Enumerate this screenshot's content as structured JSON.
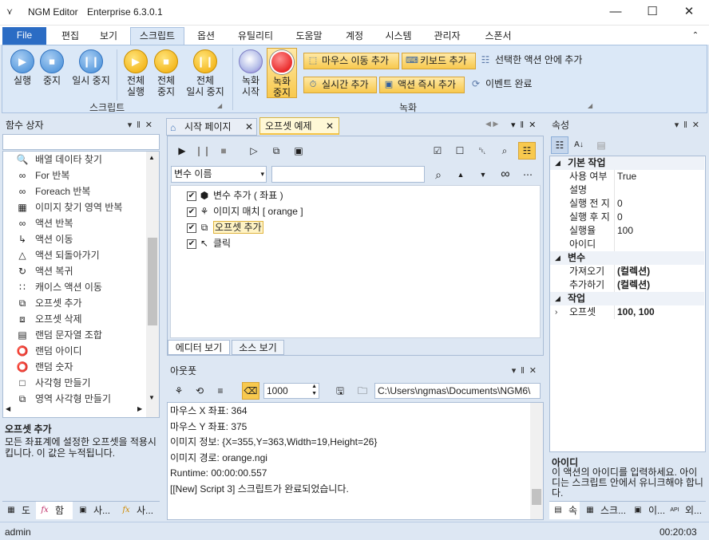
{
  "window": {
    "app_name": "NGM Editor",
    "edition": "Enterprise 6.3.0.1",
    "minimize": "—",
    "maximize": "☐",
    "close": "✕"
  },
  "ribbon_tabs": [
    "File",
    "편집",
    "보기",
    "스크립트",
    "옵션",
    "유틸리티",
    "도움말",
    "계정",
    "시스템",
    "관리자",
    "스폰서"
  ],
  "ribbon_script": {
    "run": "실행",
    "stop": "중지",
    "pause": "일시 중지",
    "run_all_1": "전체",
    "run_all_2": "실행",
    "stop_all_1": "전체",
    "stop_all_2": "중지",
    "pause_all_1": "전체",
    "pause_all_2": "일시 중지",
    "group": "스크립트"
  },
  "ribbon_record": {
    "rec_start_1": "녹화",
    "rec_start_2": "시작",
    "rec_stop_1": "녹화",
    "rec_stop_2": "중지",
    "mouse_move": "마우스 이동 추가",
    "keyboard": "키보드 추가",
    "inside_action": "선택한 액션 안에 추가",
    "realtime": "실시간 추가",
    "instant": "액션 즉시 추가",
    "event_done": "이벤트 완료",
    "group": "녹화"
  },
  "func_panel": {
    "title": "함수 상자",
    "search_value": "",
    "items": [
      {
        "icon": "search-icon",
        "glyph": "🔍",
        "label": "배열 데이타 찾기"
      },
      {
        "icon": "infinity-icon",
        "glyph": "∞",
        "label": "For 반복"
      },
      {
        "icon": "infinity-icon",
        "glyph": "∞",
        "label": "Foreach 반복"
      },
      {
        "icon": "image-search-icon",
        "glyph": "▦",
        "label": "이미지 찾기 영역 반복"
      },
      {
        "icon": "loop-icon",
        "glyph": "∞",
        "label": "액션 반복"
      },
      {
        "icon": "move-icon",
        "glyph": "↳",
        "label": "액션 이동"
      },
      {
        "icon": "return-icon",
        "glyph": "△",
        "label": "액션 되돌아가기"
      },
      {
        "icon": "restore-icon",
        "glyph": "↻",
        "label": "액션 복귀"
      },
      {
        "icon": "case-icon",
        "glyph": "∷",
        "label": "캐이스 액션 이동"
      },
      {
        "icon": "offset-add-icon",
        "glyph": "⧉",
        "label": "오프셋 추가"
      },
      {
        "icon": "offset-delete-icon",
        "glyph": "⧈",
        "label": "오프셋 삭제"
      },
      {
        "icon": "random-string-icon",
        "glyph": "▤",
        "label": "랜덤 문자열 조합"
      },
      {
        "icon": "share-icon",
        "glyph": "⭕",
        "label": "랜덤 아이디"
      },
      {
        "icon": "share-icon",
        "glyph": "⭕",
        "label": "랜덤 숫자"
      },
      {
        "icon": "rectangle-icon",
        "glyph": "□",
        "label": "사각형 만들기"
      },
      {
        "icon": "region-icon",
        "glyph": "⧉",
        "label": "영역 사각형 만들기"
      }
    ],
    "desc_title": "오프셋 추가",
    "desc_text": "모든 좌표계에 설정한 오프셋을 적용시킵니다. 이 값은 누적됩니다.",
    "tabs": [
      "도",
      "함",
      "사...",
      "사..."
    ]
  },
  "doc_tabs": {
    "start_page": "시작 페이지",
    "offset_example": "오프셋 예제"
  },
  "editor": {
    "var_select": "변수 이름",
    "var_input": "",
    "rows": [
      {
        "label": "변수 추가 ( 좌표 )",
        "icon": "cube-icon",
        "glyph": "⬢"
      },
      {
        "label": "이미지 매치 [ orange ]",
        "icon": "image-match-icon",
        "glyph": "⚘"
      },
      {
        "label": "오프셋 추가",
        "icon": "offset-icon",
        "glyph": "⧉"
      },
      {
        "label": "클릭",
        "icon": "click-icon",
        "glyph": "↖"
      }
    ],
    "bottom_tabs": [
      "에디터 보기",
      "소스 보기"
    ]
  },
  "output": {
    "title": "아웃풋",
    "count": "1000",
    "path": "C:\\Users\\ngmas\\Documents\\NGM6\\",
    "lines": [
      "마우스 X 좌표: 364",
      "마우스 Y 좌표: 375",
      "이미지 정보: {X=355,Y=363,Width=19,Height=26}",
      "이미지 경로: orange.ngi",
      "Runtime: 00:00:00.557",
      "[[New] Script 3] 스크립트가 완료되었습니다."
    ]
  },
  "properties": {
    "title": "속성",
    "rows": [
      {
        "cat": true,
        "k": "기본 작업",
        "v": ""
      },
      {
        "cat": false,
        "k": "사용 여부",
        "v": "True"
      },
      {
        "cat": false,
        "k": "설명",
        "v": ""
      },
      {
        "cat": false,
        "k": "실행 전 지",
        "v": "0"
      },
      {
        "cat": false,
        "k": "실행 후 지",
        "v": "0"
      },
      {
        "cat": false,
        "k": "실행율",
        "v": "100"
      },
      {
        "cat": false,
        "k": "아이디",
        "v": ""
      },
      {
        "cat": true,
        "k": "변수",
        "v": ""
      },
      {
        "cat": false,
        "k": "가져오기",
        "v": "(컬렉션)"
      },
      {
        "cat": false,
        "k": "추가하기",
        "v": "(컬렉션)"
      },
      {
        "cat": true,
        "k": "작업",
        "v": ""
      },
      {
        "cat": false,
        "k": "오프셋",
        "v": "100, 100"
      }
    ],
    "desc_title": "아이디",
    "desc_text": "이 액션의 아이디를 입력하세요. 아이디는 스크립트 안에서 유니크해야 합니다.",
    "tabs": [
      "속",
      "스크...",
      "이...",
      "외..."
    ]
  },
  "status": {
    "user": "admin",
    "time": "00:20:03"
  }
}
